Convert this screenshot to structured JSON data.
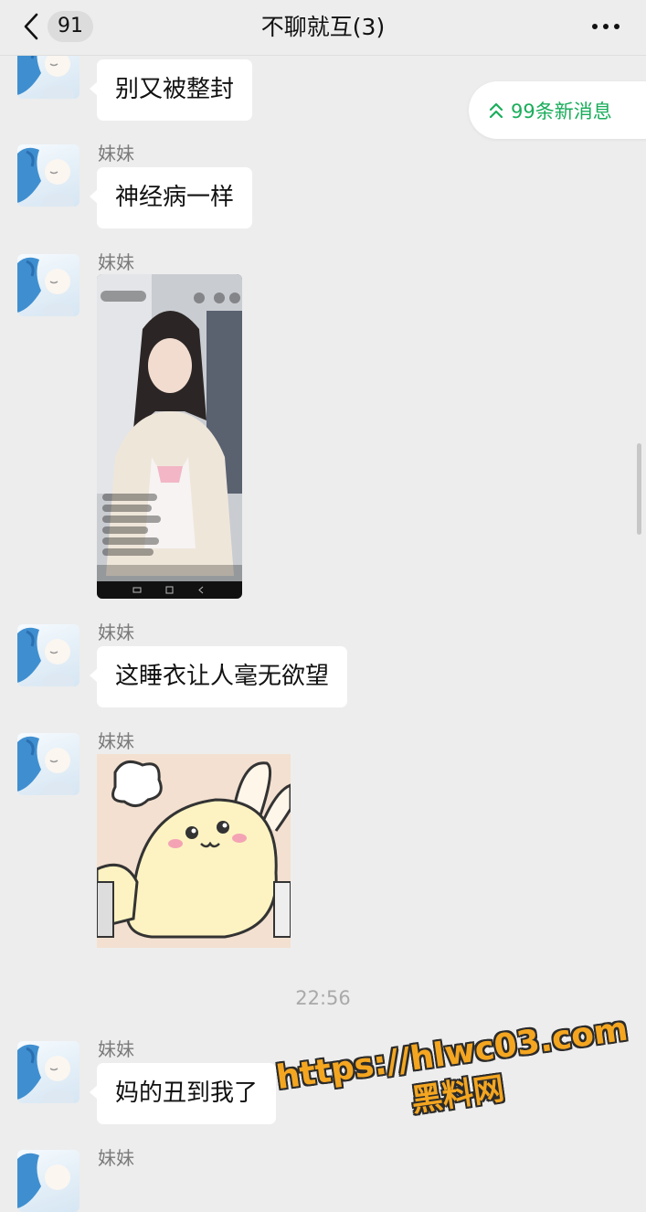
{
  "header": {
    "back_count": "91",
    "title": "不聊就互(3)"
  },
  "new_messages": {
    "label": "99条新消息",
    "accent_color": "#1aad5b"
  },
  "messages": [
    {
      "text": "别又被整封"
    },
    {
      "sender": "妹妹",
      "text": "神经病一样"
    },
    {
      "sender": "妹妹",
      "type": "image"
    },
    {
      "sender": "妹妹",
      "text": "这睡衣让人毫无欲望"
    },
    {
      "sender": "妹妹",
      "type": "sticker"
    },
    {
      "sender": "妹妹",
      "text": "妈的丑到我了"
    },
    {
      "sender": "妹妹"
    }
  ],
  "timestamp": "22:56",
  "watermark": {
    "url": "https://hlwc03.com",
    "name": "黑料网"
  }
}
